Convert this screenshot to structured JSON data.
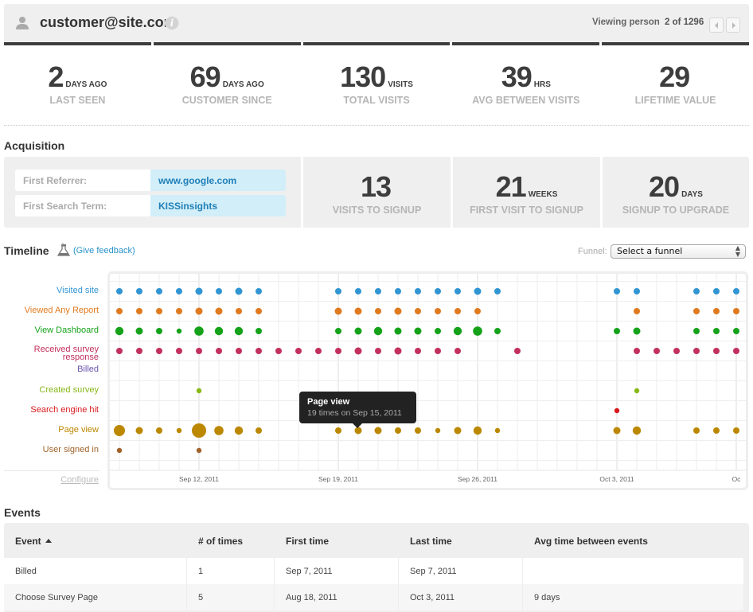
{
  "header": {
    "title": "customer@site.com",
    "viewing_label": "Viewing person",
    "viewing_count": "2 of 1296",
    "prev_label": "previous person",
    "next_label": "next person"
  },
  "stats": [
    {
      "value": "2",
      "unit": "DAYS AGO",
      "label": "LAST SEEN"
    },
    {
      "value": "69",
      "unit": "DAYS AGO",
      "label": "CUSTOMER SINCE"
    },
    {
      "value": "130",
      "unit": "VISITS",
      "label": "TOTAL VISITS"
    },
    {
      "value": "39",
      "unit": "HRS",
      "label": "AVG BETWEEN VISITS"
    },
    {
      "value": "29",
      "unit": "",
      "label": "LIFETIME VALUE"
    }
  ],
  "acquisition": {
    "title": "Acquisition",
    "fields": [
      {
        "key": "First Referrer:",
        "value": "www.google.com"
      },
      {
        "key": "First Search Term:",
        "value": "KISSinsights"
      }
    ],
    "stats": [
      {
        "value": "13",
        "unit": "",
        "label": "VISITS TO SIGNUP"
      },
      {
        "value": "21",
        "unit": "WEEKS",
        "label": "FIRST VISIT TO SIGNUP"
      },
      {
        "value": "20",
        "unit": "DAYS",
        "label": "SIGNUP TO UPGRADE"
      }
    ]
  },
  "timeline": {
    "title": "Timeline",
    "feedback_link": "(Give feedback)",
    "funnel_label": "Funnel:",
    "funnel_selected": "Select a funnel",
    "configure_label": "Configure",
    "tooltip": {
      "title": "Page view",
      "detail": "19 times on Sep 15, 2011"
    }
  },
  "chart_data": {
    "type": "scatter",
    "title": "Timeline",
    "xlabel": "",
    "ylabel": "",
    "grid": true,
    "columns": 32,
    "x_ticks": [
      {
        "col": 4,
        "label": "Sep 12, 2011"
      },
      {
        "col": 11,
        "label": "Sep 19, 2011"
      },
      {
        "col": 18,
        "label": "Sep 26, 2011"
      },
      {
        "col": 25,
        "label": "Oct 3, 2011"
      },
      {
        "col": 31,
        "label": "Oc"
      }
    ],
    "series": [
      {
        "name": "Visited site",
        "color": "#3195d3",
        "points": [
          [
            0,
            2
          ],
          [
            1,
            2
          ],
          [
            2,
            2
          ],
          [
            3,
            2
          ],
          [
            4,
            3
          ],
          [
            5,
            2
          ],
          [
            6,
            3
          ],
          [
            7,
            2
          ],
          [
            11,
            2
          ],
          [
            12,
            2
          ],
          [
            13,
            2
          ],
          [
            14,
            2
          ],
          [
            15,
            2
          ],
          [
            16,
            2
          ],
          [
            17,
            2
          ],
          [
            18,
            3
          ],
          [
            19,
            2
          ],
          [
            25,
            2
          ],
          [
            26,
            2
          ],
          [
            29,
            2
          ],
          [
            30,
            2
          ],
          [
            31,
            2
          ]
        ]
      },
      {
        "name": "Viewed Any Report",
        "color": "#e07a1f",
        "points": [
          [
            0,
            2
          ],
          [
            1,
            2
          ],
          [
            2,
            2
          ],
          [
            3,
            2
          ],
          [
            4,
            3
          ],
          [
            5,
            3
          ],
          [
            6,
            2
          ],
          [
            7,
            2
          ],
          [
            11,
            3
          ],
          [
            12,
            3
          ],
          [
            13,
            2
          ],
          [
            14,
            3
          ],
          [
            15,
            2
          ],
          [
            16,
            2
          ],
          [
            17,
            2
          ],
          [
            18,
            2
          ],
          [
            26,
            2
          ],
          [
            29,
            2
          ],
          [
            30,
            2
          ],
          [
            31,
            2
          ]
        ]
      },
      {
        "name": "View Dashboard",
        "color": "#15a21a",
        "points": [
          [
            0,
            4
          ],
          [
            1,
            3
          ],
          [
            2,
            2
          ],
          [
            3,
            1
          ],
          [
            4,
            5
          ],
          [
            5,
            4
          ],
          [
            6,
            4
          ],
          [
            7,
            2
          ],
          [
            11,
            2
          ],
          [
            12,
            3
          ],
          [
            13,
            4
          ],
          [
            14,
            3
          ],
          [
            15,
            3
          ],
          [
            16,
            2
          ],
          [
            17,
            4
          ],
          [
            18,
            5
          ],
          [
            19,
            2
          ],
          [
            25,
            2
          ],
          [
            26,
            3
          ],
          [
            29,
            2
          ],
          [
            30,
            2
          ],
          [
            31,
            2
          ]
        ]
      },
      {
        "name": "Received survey response",
        "color": "#c2305e",
        "points": [
          [
            0,
            2
          ],
          [
            1,
            2
          ],
          [
            2,
            2
          ],
          [
            3,
            2
          ],
          [
            4,
            2
          ],
          [
            5,
            2
          ],
          [
            6,
            2
          ],
          [
            7,
            2
          ],
          [
            8,
            2
          ],
          [
            9,
            2
          ],
          [
            10,
            2
          ],
          [
            11,
            2
          ],
          [
            12,
            3
          ],
          [
            13,
            2
          ],
          [
            14,
            3
          ],
          [
            15,
            2
          ],
          [
            16,
            2
          ],
          [
            17,
            2
          ],
          [
            20,
            2
          ],
          [
            26,
            2
          ],
          [
            27,
            2
          ],
          [
            28,
            2
          ],
          [
            29,
            2
          ],
          [
            30,
            2
          ],
          [
            31,
            2
          ]
        ]
      },
      {
        "name": "Billed",
        "color": "#6a55b0",
        "points": []
      },
      {
        "name": "Created survey",
        "color": "#86b817",
        "points": [
          [
            4,
            1
          ],
          [
            26,
            1
          ]
        ]
      },
      {
        "name": "Search engine hit",
        "color": "#d8181c",
        "points": [
          [
            25,
            1
          ]
        ]
      },
      {
        "name": "Page view",
        "color": "#bb8800",
        "points": [
          [
            0,
            6
          ],
          [
            1,
            3
          ],
          [
            2,
            2
          ],
          [
            3,
            1
          ],
          [
            4,
            8
          ],
          [
            5,
            5
          ],
          [
            6,
            4
          ],
          [
            7,
            2
          ],
          [
            11,
            2
          ],
          [
            12,
            3
          ],
          [
            13,
            3
          ],
          [
            14,
            2
          ],
          [
            15,
            2
          ],
          [
            16,
            1
          ],
          [
            17,
            3
          ],
          [
            18,
            4
          ],
          [
            19,
            1
          ],
          [
            25,
            3
          ],
          [
            26,
            4
          ],
          [
            29,
            2
          ],
          [
            30,
            2
          ],
          [
            31,
            2
          ]
        ]
      },
      {
        "name": "User signed in",
        "color": "#a0632a",
        "points": [
          [
            0,
            1
          ],
          [
            4,
            1
          ]
        ]
      }
    ]
  },
  "events": {
    "title": "Events",
    "columns": [
      "Event",
      "# of times",
      "First time",
      "Last time",
      "Avg time between events"
    ],
    "rows": [
      [
        "Billed",
        "1",
        "Sep 7, 2011",
        "Sep 7, 2011",
        ""
      ],
      [
        "Choose Survey Page",
        "5",
        "Aug 18, 2011",
        "Oct 3, 2011",
        "9 days"
      ]
    ]
  }
}
